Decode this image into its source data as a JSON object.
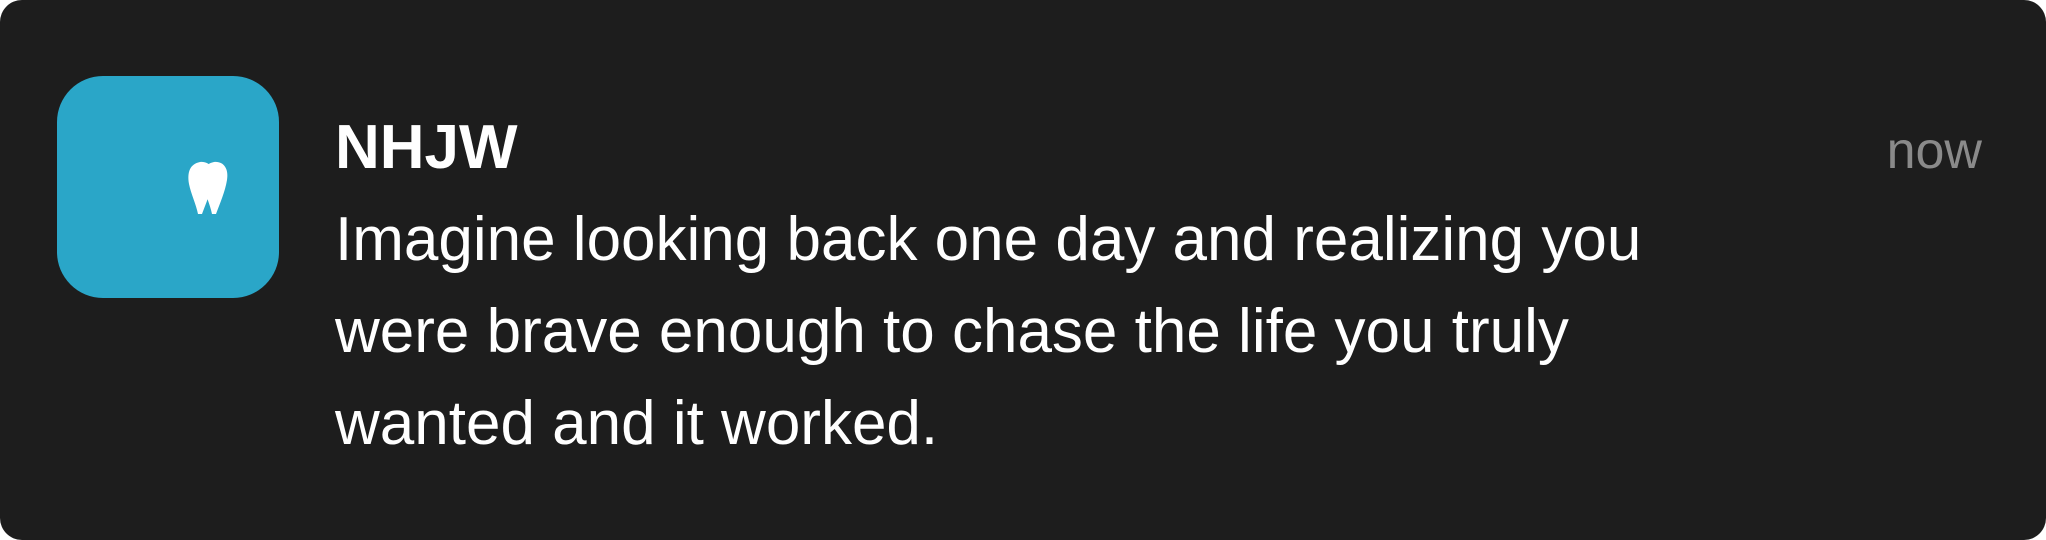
{
  "notification": {
    "app_icon": {
      "icon": "quote-icon",
      "background_color": "#2aa6c8"
    },
    "sender": "NHJW",
    "message": "Imagine looking back one day and realizing you were brave enough to chase the life you truly wanted and it worked.",
    "timestamp": "now"
  },
  "colors": {
    "background": "#1d1d1d",
    "text": "#ffffff",
    "timestamp": "#8a8a8a"
  }
}
